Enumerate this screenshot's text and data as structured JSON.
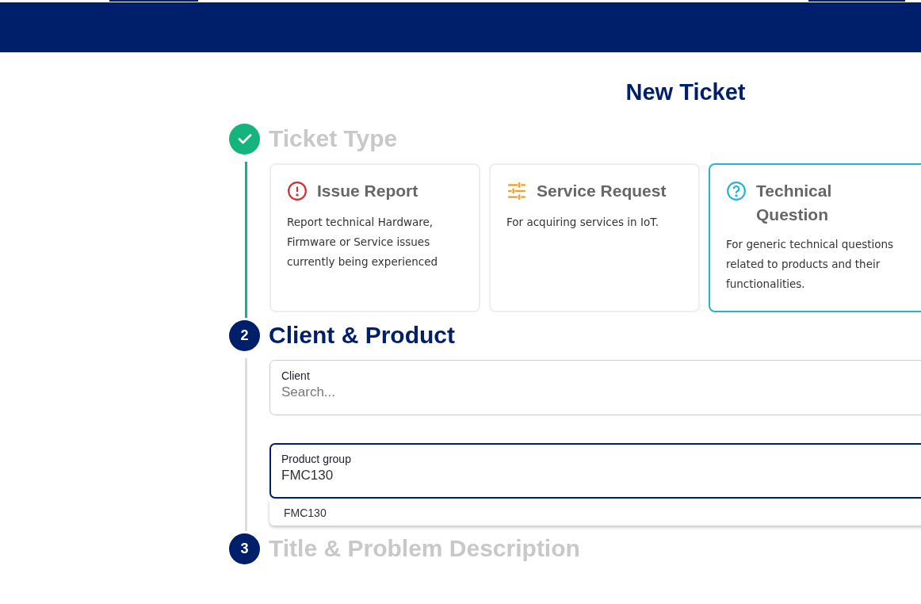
{
  "page": {
    "title": "New Ticket"
  },
  "steps": [
    {
      "completed": true,
      "active": false,
      "title": "Ticket Type",
      "kind": "cards",
      "cards": [
        {
          "kind": "alert",
          "color": "#d32f2f",
          "title": "Issue Report",
          "description": "Report technical Hardware, Firmware or Service issues currently being experienced",
          "selected": false
        },
        {
          "kind": "sliders",
          "color": "#f0a030",
          "title": "Service Request",
          "description": "For acquiring services in IoT.",
          "selected": false
        },
        {
          "kind": "help",
          "color": "#26b5d0",
          "title": "Technical Question",
          "description": "For generic technical questions related to products and their functionalities.",
          "selected": true
        }
      ]
    },
    {
      "number": "2",
      "completed": false,
      "active": true,
      "title": "Client & Product",
      "kind": "fields",
      "fields": [
        {
          "label": "Client",
          "placeholder": "Search...",
          "focused": false
        },
        {
          "label": "Product group",
          "value": "FMC130",
          "focused": true,
          "options": [
            "FMC130"
          ]
        }
      ]
    },
    {
      "number": "3",
      "completed": false,
      "active": false,
      "title": "Title & Problem Description",
      "kind": "empty"
    }
  ]
}
